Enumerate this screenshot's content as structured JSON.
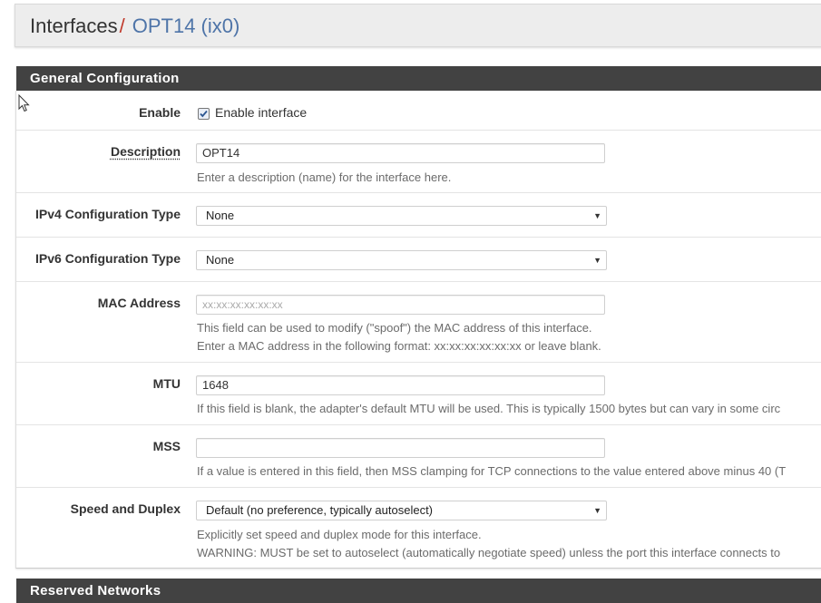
{
  "breadcrumb": {
    "parent": "Interfaces",
    "separator": "/",
    "current": "OPT14 (ix0)"
  },
  "sections": {
    "general": "General Configuration",
    "reserved": "Reserved Networks"
  },
  "form": {
    "enable": {
      "label": "Enable",
      "checkbox_label": "Enable interface",
      "checked": true
    },
    "description": {
      "label": "Description",
      "value": "OPT14",
      "help": "Enter a description (name) for the interface here."
    },
    "ipv4": {
      "label": "IPv4 Configuration Type",
      "value": "None"
    },
    "ipv6": {
      "label": "IPv6 Configuration Type",
      "value": "None"
    },
    "mac": {
      "label": "MAC Address",
      "placeholder": "xx:xx:xx:xx:xx:xx",
      "help1": "This field can be used to modify (\"spoof\") the MAC address of this interface.",
      "help2": "Enter a MAC address in the following format: xx:xx:xx:xx:xx:xx or leave blank."
    },
    "mtu": {
      "label": "MTU",
      "value": "1648",
      "help": "If this field is blank, the adapter's default MTU will be used. This is typically 1500 bytes but can vary in some circ"
    },
    "mss": {
      "label": "MSS",
      "value": "",
      "help": "If a value is entered in this field, then MSS clamping for TCP connections to the value entered above minus 40 (T"
    },
    "speed": {
      "label": "Speed and Duplex",
      "value": "Default (no preference, typically autoselect)",
      "help1": "Explicitly set speed and duplex mode for this interface.",
      "help2": "WARNING: MUST be set to autoselect (automatically negotiate speed) unless the port this interface connects to"
    }
  },
  "colors": {
    "accent": "#4e74a8",
    "separator": "#c0392b",
    "heading_bg": "#424242"
  },
  "icons": {
    "checkbox": "check-icon",
    "select_caret": "caret-down-icon",
    "cursor": "mouse-pointer-icon"
  }
}
